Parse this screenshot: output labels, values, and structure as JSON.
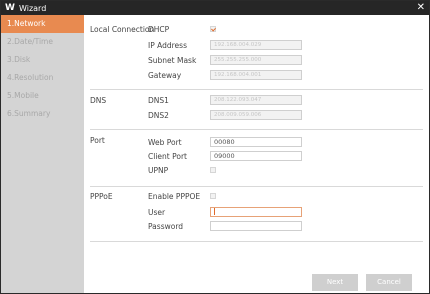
{
  "window": {
    "logo": "W",
    "title": "Wizard",
    "close_icon": "close-icon"
  },
  "sidebar": {
    "items": [
      {
        "label": "1.Network",
        "active": true
      },
      {
        "label": "2.Date/Time"
      },
      {
        "label": "3.Disk"
      },
      {
        "label": "4.Resolution"
      },
      {
        "label": "5.Mobile"
      },
      {
        "label": "6.Summary"
      }
    ]
  },
  "local_connection": {
    "section_label": "Local Connection",
    "dhcp_label": "DHCP",
    "dhcp_checked": true,
    "ip_label": "IP Address",
    "ip_value": "192.168.004.029",
    "subnet_label": "Subnet Mask",
    "subnet_value": "255.255.255.000",
    "gateway_label": "Gateway",
    "gateway_value": "192.168.004.001"
  },
  "dns": {
    "section_label": "DNS",
    "dns1_label": "DNS1",
    "dns1_value": "208.122.093.047",
    "dns2_label": "DNS2",
    "dns2_value": "208.009.059.006"
  },
  "port": {
    "section_label": "Port",
    "web_label": "Web Port",
    "web_value": "00080",
    "client_label": "Client Port",
    "client_value": "09000",
    "upnp_label": "UPNP",
    "upnp_checked": false
  },
  "pppoe": {
    "section_label": "PPPoE",
    "enable_label": "Enable PPPOE",
    "enable_checked": false,
    "user_label": "User",
    "user_value": "",
    "password_label": "Password",
    "password_value": ""
  },
  "buttons": {
    "next": "Next",
    "cancel": "Cancel"
  },
  "colors": {
    "accent": "#e88a50",
    "titlebar": "#262626",
    "sidebar": "#d4d4d4",
    "button": "#cfcfcf"
  }
}
